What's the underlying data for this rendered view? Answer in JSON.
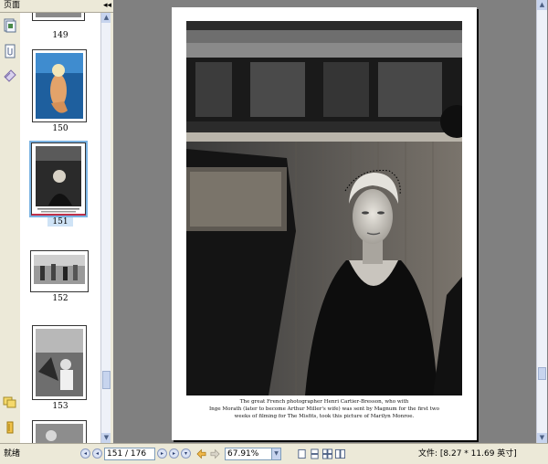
{
  "panel": {
    "title": "页面",
    "collapse_glyph": "◂◂"
  },
  "thumbnails": [
    {
      "page_label": "149"
    },
    {
      "page_label": "150"
    },
    {
      "page_label": "151"
    },
    {
      "page_label": "152"
    },
    {
      "page_label": "153"
    }
  ],
  "selected_page": "151",
  "document": {
    "caption_lines": [
      "The great French photographer Henri Cartier-Bresson, who with",
      "Inge Morath (later to become Arthur Miller's wife) was sent by Magnum for the first two",
      "weeks of filming for The Misfits, took this picture of Marilyn Monroe."
    ]
  },
  "statusbar": {
    "status_text": "就绪",
    "page_field": "151 / 176",
    "zoom_field": "67.91%",
    "file_info": "文件: [8.27 * 11.69 英寸]"
  },
  "icons": {
    "pages": "pages-icon",
    "attachments": "attachments-icon",
    "signatures": "signatures-icon",
    "comments": "comments-icon",
    "layers": "layers-icon"
  },
  "colors": {
    "chrome": "#ece9d8",
    "doc_background": "#808080",
    "selection_outline": "#7ab3e3",
    "selection_marker": "#c0304a"
  }
}
